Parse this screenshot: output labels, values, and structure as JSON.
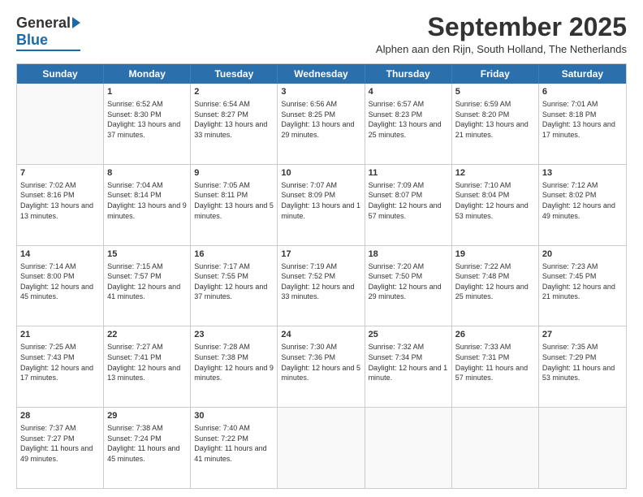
{
  "logo": {
    "general": "General",
    "blue": "Blue"
  },
  "title": "September 2025",
  "subtitle": "Alphen aan den Rijn, South Holland, The Netherlands",
  "days_of_week": [
    "Sunday",
    "Monday",
    "Tuesday",
    "Wednesday",
    "Thursday",
    "Friday",
    "Saturday"
  ],
  "weeks": [
    [
      {
        "day": "",
        "empty": true
      },
      {
        "day": "1",
        "sunrise": "Sunrise: 6:52 AM",
        "sunset": "Sunset: 8:30 PM",
        "daylight": "Daylight: 13 hours and 37 minutes."
      },
      {
        "day": "2",
        "sunrise": "Sunrise: 6:54 AM",
        "sunset": "Sunset: 8:27 PM",
        "daylight": "Daylight: 13 hours and 33 minutes."
      },
      {
        "day": "3",
        "sunrise": "Sunrise: 6:56 AM",
        "sunset": "Sunset: 8:25 PM",
        "daylight": "Daylight: 13 hours and 29 minutes."
      },
      {
        "day": "4",
        "sunrise": "Sunrise: 6:57 AM",
        "sunset": "Sunset: 8:23 PM",
        "daylight": "Daylight: 13 hours and 25 minutes."
      },
      {
        "day": "5",
        "sunrise": "Sunrise: 6:59 AM",
        "sunset": "Sunset: 8:20 PM",
        "daylight": "Daylight: 13 hours and 21 minutes."
      },
      {
        "day": "6",
        "sunrise": "Sunrise: 7:01 AM",
        "sunset": "Sunset: 8:18 PM",
        "daylight": "Daylight: 13 hours and 17 minutes."
      }
    ],
    [
      {
        "day": "7",
        "sunrise": "Sunrise: 7:02 AM",
        "sunset": "Sunset: 8:16 PM",
        "daylight": "Daylight: 13 hours and 13 minutes."
      },
      {
        "day": "8",
        "sunrise": "Sunrise: 7:04 AM",
        "sunset": "Sunset: 8:14 PM",
        "daylight": "Daylight: 13 hours and 9 minutes."
      },
      {
        "day": "9",
        "sunrise": "Sunrise: 7:05 AM",
        "sunset": "Sunset: 8:11 PM",
        "daylight": "Daylight: 13 hours and 5 minutes."
      },
      {
        "day": "10",
        "sunrise": "Sunrise: 7:07 AM",
        "sunset": "Sunset: 8:09 PM",
        "daylight": "Daylight: 13 hours and 1 minute."
      },
      {
        "day": "11",
        "sunrise": "Sunrise: 7:09 AM",
        "sunset": "Sunset: 8:07 PM",
        "daylight": "Daylight: 12 hours and 57 minutes."
      },
      {
        "day": "12",
        "sunrise": "Sunrise: 7:10 AM",
        "sunset": "Sunset: 8:04 PM",
        "daylight": "Daylight: 12 hours and 53 minutes."
      },
      {
        "day": "13",
        "sunrise": "Sunrise: 7:12 AM",
        "sunset": "Sunset: 8:02 PM",
        "daylight": "Daylight: 12 hours and 49 minutes."
      }
    ],
    [
      {
        "day": "14",
        "sunrise": "Sunrise: 7:14 AM",
        "sunset": "Sunset: 8:00 PM",
        "daylight": "Daylight: 12 hours and 45 minutes."
      },
      {
        "day": "15",
        "sunrise": "Sunrise: 7:15 AM",
        "sunset": "Sunset: 7:57 PM",
        "daylight": "Daylight: 12 hours and 41 minutes."
      },
      {
        "day": "16",
        "sunrise": "Sunrise: 7:17 AM",
        "sunset": "Sunset: 7:55 PM",
        "daylight": "Daylight: 12 hours and 37 minutes."
      },
      {
        "day": "17",
        "sunrise": "Sunrise: 7:19 AM",
        "sunset": "Sunset: 7:52 PM",
        "daylight": "Daylight: 12 hours and 33 minutes."
      },
      {
        "day": "18",
        "sunrise": "Sunrise: 7:20 AM",
        "sunset": "Sunset: 7:50 PM",
        "daylight": "Daylight: 12 hours and 29 minutes."
      },
      {
        "day": "19",
        "sunrise": "Sunrise: 7:22 AM",
        "sunset": "Sunset: 7:48 PM",
        "daylight": "Daylight: 12 hours and 25 minutes."
      },
      {
        "day": "20",
        "sunrise": "Sunrise: 7:23 AM",
        "sunset": "Sunset: 7:45 PM",
        "daylight": "Daylight: 12 hours and 21 minutes."
      }
    ],
    [
      {
        "day": "21",
        "sunrise": "Sunrise: 7:25 AM",
        "sunset": "Sunset: 7:43 PM",
        "daylight": "Daylight: 12 hours and 17 minutes."
      },
      {
        "day": "22",
        "sunrise": "Sunrise: 7:27 AM",
        "sunset": "Sunset: 7:41 PM",
        "daylight": "Daylight: 12 hours and 13 minutes."
      },
      {
        "day": "23",
        "sunrise": "Sunrise: 7:28 AM",
        "sunset": "Sunset: 7:38 PM",
        "daylight": "Daylight: 12 hours and 9 minutes."
      },
      {
        "day": "24",
        "sunrise": "Sunrise: 7:30 AM",
        "sunset": "Sunset: 7:36 PM",
        "daylight": "Daylight: 12 hours and 5 minutes."
      },
      {
        "day": "25",
        "sunrise": "Sunrise: 7:32 AM",
        "sunset": "Sunset: 7:34 PM",
        "daylight": "Daylight: 12 hours and 1 minute."
      },
      {
        "day": "26",
        "sunrise": "Sunrise: 7:33 AM",
        "sunset": "Sunset: 7:31 PM",
        "daylight": "Daylight: 11 hours and 57 minutes."
      },
      {
        "day": "27",
        "sunrise": "Sunrise: 7:35 AM",
        "sunset": "Sunset: 7:29 PM",
        "daylight": "Daylight: 11 hours and 53 minutes."
      }
    ],
    [
      {
        "day": "28",
        "sunrise": "Sunrise: 7:37 AM",
        "sunset": "Sunset: 7:27 PM",
        "daylight": "Daylight: 11 hours and 49 minutes."
      },
      {
        "day": "29",
        "sunrise": "Sunrise: 7:38 AM",
        "sunset": "Sunset: 7:24 PM",
        "daylight": "Daylight: 11 hours and 45 minutes."
      },
      {
        "day": "30",
        "sunrise": "Sunrise: 7:40 AM",
        "sunset": "Sunset: 7:22 PM",
        "daylight": "Daylight: 11 hours and 41 minutes."
      },
      {
        "day": "",
        "empty": true
      },
      {
        "day": "",
        "empty": true
      },
      {
        "day": "",
        "empty": true
      },
      {
        "day": "",
        "empty": true
      }
    ]
  ]
}
